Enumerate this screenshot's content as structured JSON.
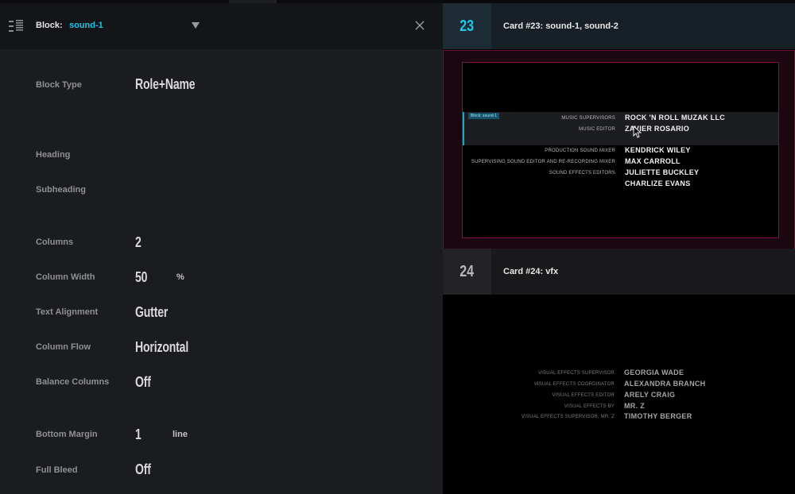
{
  "panel": {
    "block_label": "Block:",
    "block_value": "sound-1",
    "rows": {
      "block_type": {
        "label": "Block Type",
        "value": "Role+Name"
      },
      "heading": {
        "label": "Heading"
      },
      "subheading": {
        "label": "Subheading"
      },
      "columns": {
        "label": "Columns",
        "value": "2"
      },
      "column_width": {
        "label": "Column Width",
        "value": "50",
        "unit": "%"
      },
      "text_alignment": {
        "label": "Text Alignment",
        "value": "Gutter"
      },
      "column_flow": {
        "label": "Column Flow",
        "value": "Horizontal"
      },
      "balance_columns": {
        "label": "Balance Columns",
        "value": "Off"
      },
      "bottom_margin": {
        "label": "Bottom Margin",
        "value": "1",
        "unit": "line"
      },
      "full_bleed": {
        "label": "Full Bleed",
        "value": "Off"
      }
    }
  },
  "cards": [
    {
      "number": "23",
      "title": "Card #23:  sound-1, sound-2",
      "block_tag": "Block: sound-1",
      "credits": [
        {
          "role": "MUSIC SUPERVISORS",
          "name": "ROCK 'N ROLL MUZAK LLC"
        },
        {
          "role": "MUSIC EDITOR",
          "name": "ZAVIER ROSARIO"
        },
        {
          "role": "PRODUCTION SOUND MIXER",
          "name": "KENDRICK WILEY"
        },
        {
          "role": "SUPERVISING SOUND EDITOR AND RE-RECORDING MIXER",
          "name": "MAX CARROLL"
        },
        {
          "role": "SOUND EFFECTS EDITORS",
          "name": "JULIETTE BUCKLEY"
        },
        {
          "role": "",
          "name": "CHARLIZE EVANS"
        }
      ]
    },
    {
      "number": "24",
      "title": "Card #24:  vfx",
      "credits": [
        {
          "role": "VISUAL EFFECTS SUPERVISOR",
          "name": "GEORGIA WADE"
        },
        {
          "role": "VISUAL EFFECTS COORDINATOR",
          "name": "ALEXANDRA BRANCH"
        },
        {
          "role": "VISUAL EFFECTS EDITOR",
          "name": "ARELY CRAIG"
        },
        {
          "role": "VISUAL EFFECTS BY",
          "name": "MR. Z"
        },
        {
          "role": "VISUAL EFFECTS SUPERVISOR, MR. Z",
          "name": "TIMOTHY BERGER"
        }
      ]
    }
  ],
  "colors": {
    "accent": "#18c4e6",
    "card_border": "#781446"
  },
  "icons": {
    "menu": "menu-icon",
    "dropdown": "chevron-down-icon",
    "close": "close-icon",
    "cursor": "cursor-icon"
  }
}
